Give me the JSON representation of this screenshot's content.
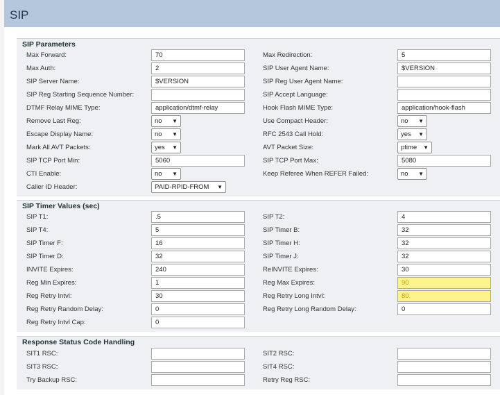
{
  "header": {
    "title": "SIP"
  },
  "sections": [
    {
      "title": "SIP Parameters",
      "rows": [
        {
          "left": {
            "label": "Max Forward:",
            "type": "input",
            "value": "70"
          },
          "right": {
            "label": "Max Redirection:",
            "type": "input",
            "value": "5"
          }
        },
        {
          "left": {
            "label": "Max Auth:",
            "type": "input",
            "value": "2"
          },
          "right": {
            "label": "SIP User Agent Name:",
            "type": "input",
            "value": "$VERSION"
          }
        },
        {
          "left": {
            "label": "SIP Server Name:",
            "type": "input",
            "value": "$VERSION"
          },
          "right": {
            "label": "SIP Reg User Agent Name:",
            "type": "input",
            "value": ""
          }
        },
        {
          "left": {
            "label": "SIP Reg Starting Sequence Number:",
            "type": "input",
            "value": ""
          },
          "right": {
            "label": "SIP Accept Language:",
            "type": "input",
            "value": ""
          }
        },
        {
          "left": {
            "label": "DTMF Relay MIME Type:",
            "type": "input",
            "value": "application/dtmf-relay"
          },
          "right": {
            "label": "Hook Flash MIME Type:",
            "type": "input",
            "value": "application/hook-flash"
          }
        },
        {
          "left": {
            "label": "Remove Last Reg:",
            "type": "select",
            "value": "no"
          },
          "right": {
            "label": "Use Compact Header:",
            "type": "select",
            "value": "no"
          }
        },
        {
          "left": {
            "label": "Escape Display Name:",
            "type": "select",
            "value": "no"
          },
          "right": {
            "label": "RFC 2543 Call Hold:",
            "type": "select",
            "value": "yes"
          }
        },
        {
          "left": {
            "label": "Mark All AVT Packets:",
            "type": "select",
            "value": "yes"
          },
          "right": {
            "label": "AVT Packet Size:",
            "type": "select",
            "value": "ptime"
          }
        },
        {
          "left": {
            "label": "SIP TCP Port Min:",
            "type": "input",
            "value": "5060"
          },
          "right": {
            "label": "SIP TCP Port Max:",
            "type": "input",
            "value": "5080"
          }
        },
        {
          "left": {
            "label": "CTI Enable:",
            "type": "select",
            "value": "no"
          },
          "right": {
            "label": "Keep Referee When REFER Failed:",
            "type": "select",
            "value": "no"
          }
        },
        {
          "left": {
            "label": "Caller ID Header:",
            "type": "select",
            "value": "PAID-RPID-FROM"
          },
          "right": null
        }
      ]
    },
    {
      "title": "SIP Timer Values (sec)",
      "rows": [
        {
          "left": {
            "label": "SIP T1:",
            "type": "input",
            "value": ".5"
          },
          "right": {
            "label": "SIP T2:",
            "type": "input",
            "value": "4"
          }
        },
        {
          "left": {
            "label": "SIP T4:",
            "type": "input",
            "value": "5"
          },
          "right": {
            "label": "SIP Timer B:",
            "type": "input",
            "value": "32"
          }
        },
        {
          "left": {
            "label": "SIP Timer F:",
            "type": "input",
            "value": "16"
          },
          "right": {
            "label": "SIP Timer H:",
            "type": "input",
            "value": "32"
          }
        },
        {
          "left": {
            "label": "SIP Timer D:",
            "type": "input",
            "value": "32"
          },
          "right": {
            "label": "SIP Timer J:",
            "type": "input",
            "value": "32"
          }
        },
        {
          "left": {
            "label": "INVITE Expires:",
            "type": "input",
            "value": "240"
          },
          "right": {
            "label": "ReINVITE Expires:",
            "type": "input",
            "value": "30"
          }
        },
        {
          "left": {
            "label": "Reg Min Expires:",
            "type": "input",
            "value": "1"
          },
          "right": {
            "label": "Reg Max Expires:",
            "type": "input",
            "value": "90",
            "highlight": true
          }
        },
        {
          "left": {
            "label": "Reg Retry Intvl:",
            "type": "input",
            "value": "30"
          },
          "right": {
            "label": "Reg Retry Long Intvl:",
            "type": "input",
            "value": "80",
            "highlight": true
          }
        },
        {
          "left": {
            "label": "Reg Retry Random Delay:",
            "type": "input",
            "value": "0"
          },
          "right": {
            "label": "Reg Retry Long Random Delay:",
            "type": "input",
            "value": "0"
          }
        },
        {
          "left": {
            "label": "Reg Retry Intvl Cap:",
            "type": "input",
            "value": "0"
          },
          "right": null
        }
      ]
    },
    {
      "title": "Response Status Code Handling",
      "rows": [
        {
          "left": {
            "label": "SIT1 RSC:",
            "type": "input",
            "value": ""
          },
          "right": {
            "label": "SIT2 RSC:",
            "type": "input",
            "value": ""
          }
        },
        {
          "left": {
            "label": "SIT3 RSC:",
            "type": "input",
            "value": ""
          },
          "right": {
            "label": "SIT4 RSC:",
            "type": "input",
            "value": ""
          }
        },
        {
          "left": {
            "label": "Try Backup RSC:",
            "type": "input",
            "value": ""
          },
          "right": {
            "label": "Retry Reg RSC:",
            "type": "input",
            "value": ""
          }
        }
      ]
    }
  ],
  "colors": {
    "header_bg": "#b5c7dc",
    "section_bg": "#eef0f3",
    "highlight": "#fff48c"
  }
}
